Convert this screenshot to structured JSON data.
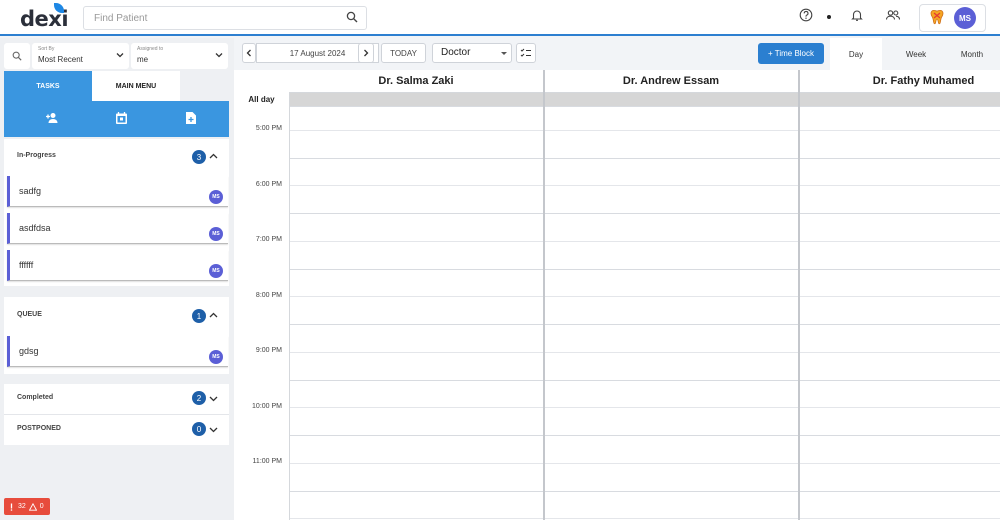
{
  "header": {
    "logo": "dexi",
    "search_placeholder": "Find Patient",
    "user_initials": "MS"
  },
  "filters": {
    "sort_label": "Sort By",
    "sort_value": "Most Recent",
    "assigned_label": "Assigned to",
    "assigned_value": "me"
  },
  "tabs": {
    "tasks": "TASKS",
    "main_menu": "MAIN MENU"
  },
  "sections": {
    "in_progress": {
      "title": "In-Progress",
      "count": "3",
      "items": [
        {
          "name": "sadfg",
          "initials": "MS"
        },
        {
          "name": "asdfdsa",
          "initials": "MS"
        },
        {
          "name": "ffffff",
          "initials": "MS"
        }
      ]
    },
    "queue": {
      "title": "QUEUE",
      "count": "1",
      "items": [
        {
          "name": "gdsg",
          "initials": "MS"
        }
      ]
    },
    "completed": {
      "title": "Completed",
      "count": "2"
    },
    "postponed": {
      "title": "POSTPONED",
      "count": "0"
    }
  },
  "alerts": {
    "errors": "32",
    "warnings": "0",
    "error_color": "#e74c3c"
  },
  "calendar": {
    "date": "17 August 2024",
    "today_label": "TODAY",
    "resource_select": "Doctor",
    "time_block_label": "+ Time Block",
    "views": [
      "Day",
      "Week",
      "Month"
    ],
    "active_view": "Day",
    "doctors": [
      "Dr. Salma Zaki",
      "Dr. Andrew Essam",
      "Dr. Fathy Muhamed"
    ],
    "all_day_label": "All day",
    "times": [
      "5:00 PM",
      "6:00 PM",
      "7:00 PM",
      "8:00 PM",
      "9:00 PM",
      "10:00 PM",
      "11:00 PM"
    ]
  },
  "colors": {
    "accent": "#3a96e0",
    "primary_button": "#2b7fd0",
    "avatar": "#5b5fd6",
    "badge": "#1e5fa8"
  }
}
